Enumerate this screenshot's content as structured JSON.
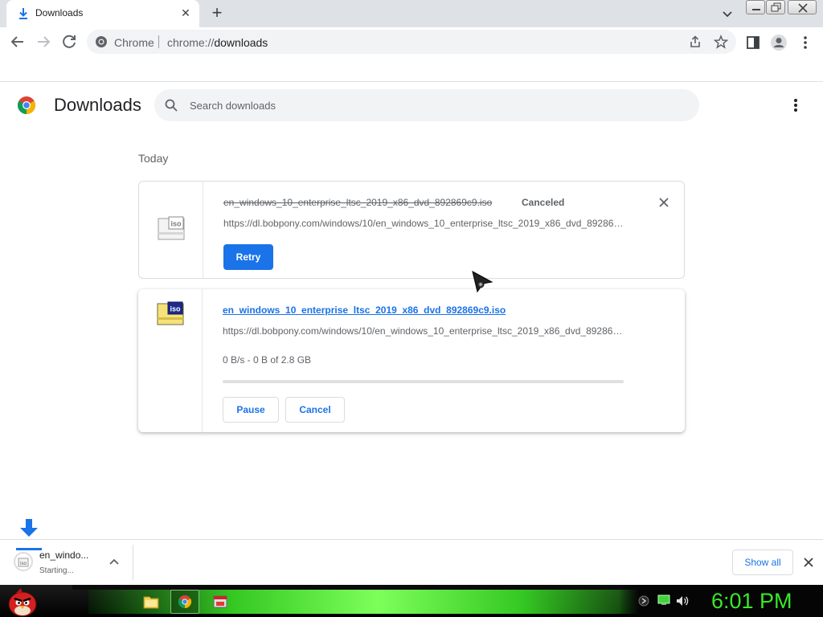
{
  "tab": {
    "title": "Downloads",
    "icon": "download-icon"
  },
  "window": {
    "controls": [
      "minimize",
      "restore",
      "close"
    ]
  },
  "omnibox": {
    "site_label": "Chrome",
    "url_scheme": "chrome://",
    "url_host": "downloads"
  },
  "page": {
    "title": "Downloads",
    "search_placeholder": "Search downloads",
    "section_label": "Today"
  },
  "downloads": [
    {
      "file_name": "en_windows_10_enterprise_ltsc_2019_x86_dvd_892869c9.iso",
      "status": "Canceled",
      "url": "https://dl.bobpony.com/windows/10/en_windows_10_enterprise_ltsc_2019_x86_dvd_892869c9.iso",
      "action": "Retry",
      "icon": "iso-file-icon"
    },
    {
      "file_name": "en_windows_10_enterprise_ltsc_2019_x86_dvd_892869c9.iso",
      "url": "https://dl.bobpony.com/windows/10/en_windows_10_enterprise_ltsc_2019_x86_dvd_892869c9.iso",
      "progress_text": "0 B/s - 0 B of 2.8 GB",
      "progress_fraction": 0,
      "actions": {
        "pause": "Pause",
        "cancel": "Cancel"
      },
      "icon": "iso-file-icon"
    }
  ],
  "shelf": {
    "item_name": "en_windo...",
    "item_status": "Starting...",
    "show_all": "Show all"
  },
  "taskbar": {
    "clock": "6:01 PM"
  },
  "colors": {
    "accent": "#1a73e8",
    "taskbar_glow": "#35c823",
    "clock": "#39e82a"
  }
}
